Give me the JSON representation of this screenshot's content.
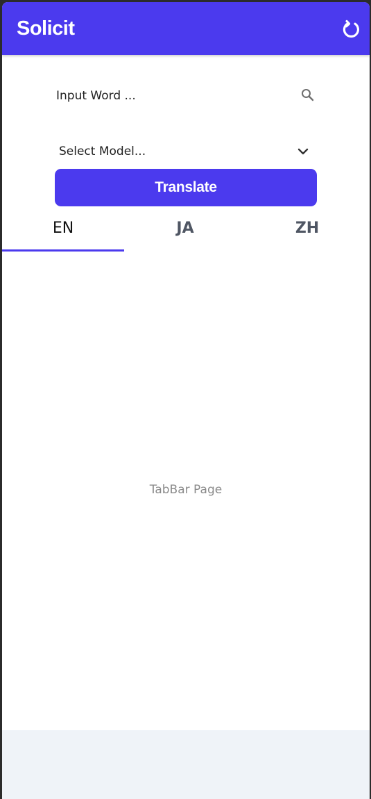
{
  "app": {
    "title": "Solicit",
    "refresh_icon": "refresh-icon"
  },
  "search": {
    "placeholder": "Input Word ...",
    "value": "",
    "icon": "search-icon"
  },
  "model_select": {
    "selected_label": "Select Model...",
    "icon": "chevron-down-icon"
  },
  "translate_button": {
    "label": "Translate"
  },
  "tabs": [
    {
      "label": "EN",
      "active": true
    },
    {
      "label": "JA",
      "active": false
    },
    {
      "label": "ZH",
      "active": false
    }
  ],
  "tab_page": {
    "text": "TabBar Page"
  },
  "colors": {
    "primary": "#4b3aee",
    "background": "#ffffff",
    "bottom_area": "#eff3f8",
    "muted_text": "#8a8a8a",
    "inactive_tab": "#4f5663"
  }
}
